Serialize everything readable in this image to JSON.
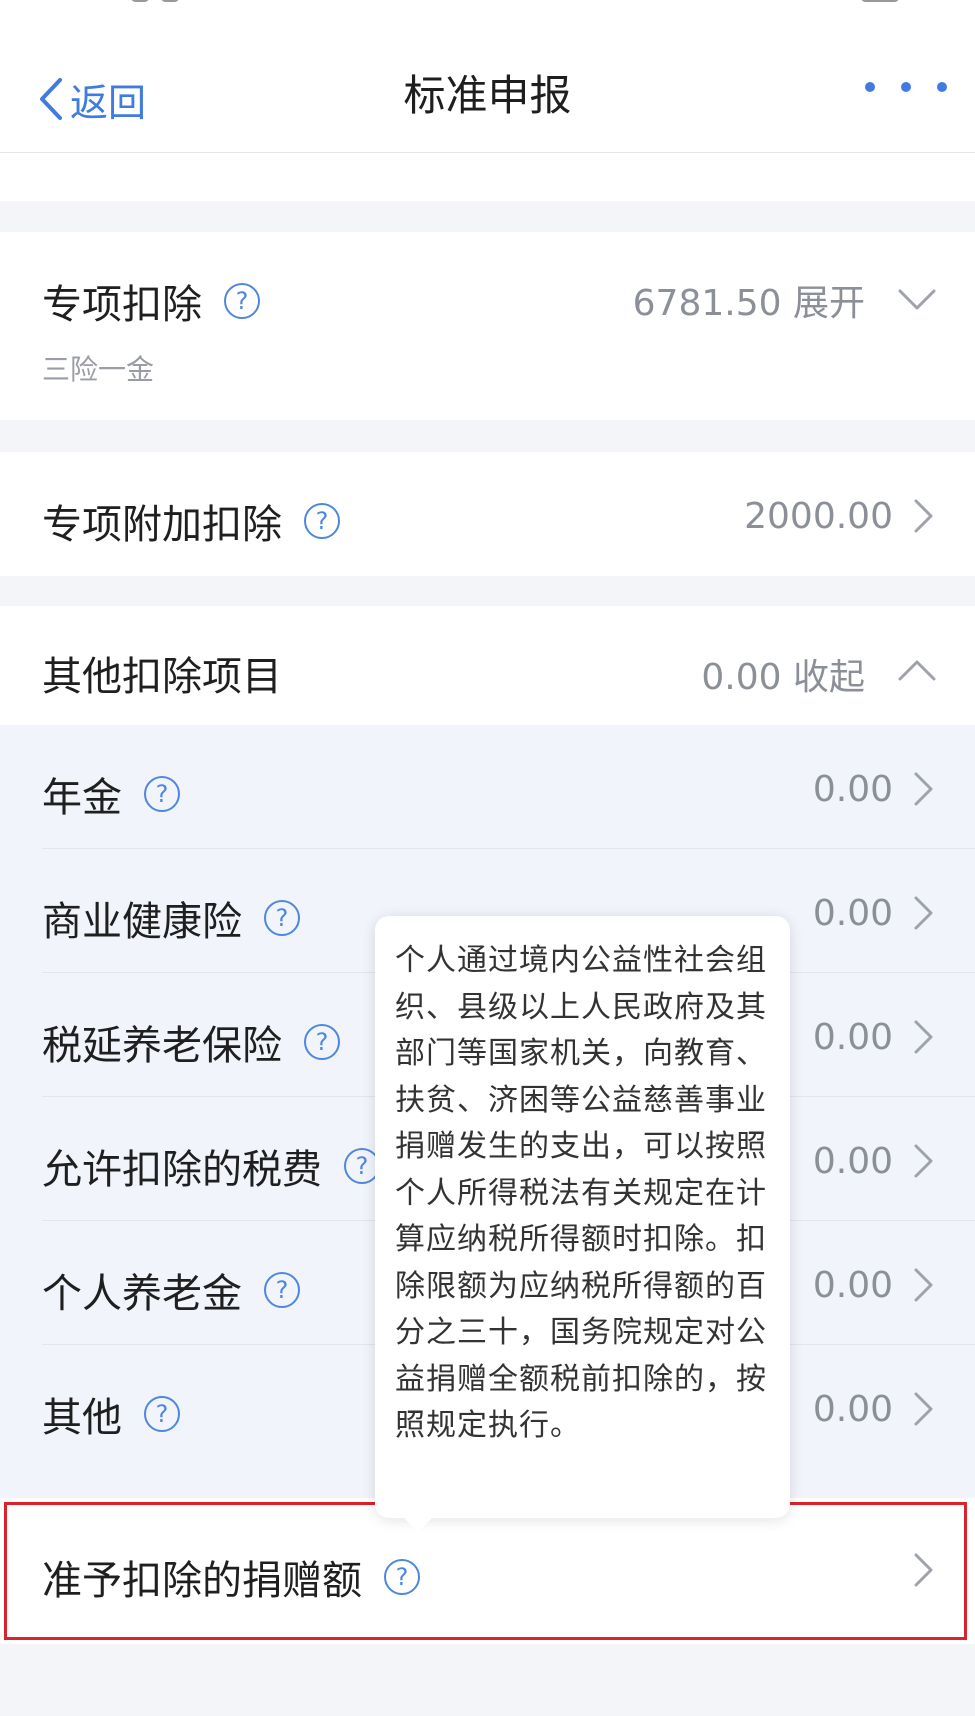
{
  "nav": {
    "back_label": "返回",
    "title": "标准申报",
    "more_icon": "more-dots-icon"
  },
  "colors": {
    "accent": "#3f7be0",
    "highlight": "#d9232d"
  },
  "special_deduction": {
    "label": "专项扣除",
    "sub_label": "三险一金",
    "value": "6781.50",
    "toggle": "展开"
  },
  "special_additional": {
    "label": "专项附加扣除",
    "value": "2000.00"
  },
  "other_deductions": {
    "label": "其他扣除项目",
    "value": "0.00",
    "toggle": "收起",
    "items": [
      {
        "label": "年金",
        "value": "0.00"
      },
      {
        "label": "商业健康险",
        "value": "0.00"
      },
      {
        "label": "税延养老保险",
        "value": "0.00"
      },
      {
        "label": "允许扣除的税费",
        "value": "0.00"
      },
      {
        "label": "个人养老金",
        "value": "0.00"
      },
      {
        "label": "其他",
        "value": "0.00"
      }
    ]
  },
  "donation": {
    "label": "准予扣除的捐赠额"
  },
  "tooltip": {
    "text": "个人通过境内公益性社会组织、县级以上人民政府及其部门等国家机关，向教育、扶贫、济困等公益慈善事业捐赠发生的支出，可以按照个人所得税法有关规定在计算应纳税所得额时扣除。扣除限额为应纳税所得额的百分之三十，国务院规定对公益捐赠全额税前扣除的，按照规定执行。"
  }
}
